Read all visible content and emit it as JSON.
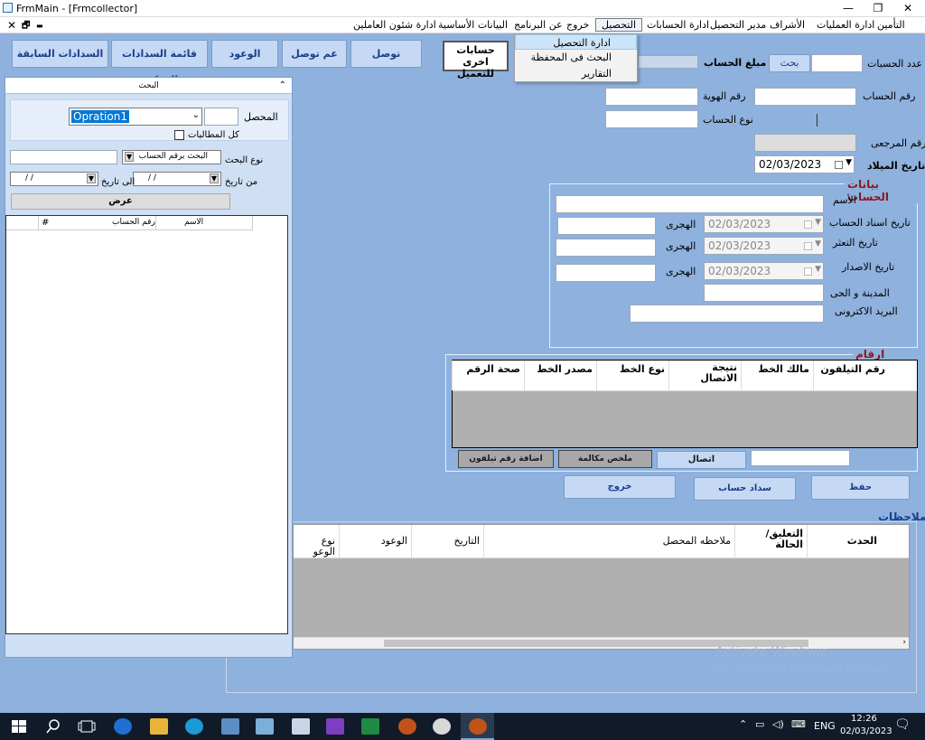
{
  "window": {
    "title": "FrmMain - [Frmcollector]",
    "min": "—",
    "max": "❐",
    "close": "✕"
  },
  "mdi": {
    "close": "✕",
    "restore": "🗗",
    "min": "▬"
  },
  "menu": [
    "التأمين",
    "ادارة العمليات",
    "الأشراف",
    "مدير التحصيل",
    "ادارة الحسابات",
    "التحصيل",
    "خروج",
    "عن البرنامج",
    "البيانات الأساسية",
    "ادارة شئون العاملين"
  ],
  "dropdown": [
    "ادارة التحصيل",
    "البحث فى المحفظة",
    "التقارير"
  ],
  "toolbar": {
    "other_accounts": "حسابات اخرى للتعميل",
    "reach": "توصل",
    "no_reach": "عم توصل",
    "promises": "الوعود",
    "confirmed_payments": "قائمة السدادات المؤكدة",
    "prev_payments": "السدادات السابقة"
  },
  "top": {
    "accounts_count_label": "عدد الحسبات",
    "search_btn": "بحث",
    "amount_label": "مبلغ الحساب",
    "account_no_label": "رقم الحساب",
    "id_no_label": "رقم الهوية",
    "account_type_label": "نوع الحساب",
    "ref_no_label": "الرقم المرجعى",
    "dob_label": "تاريخ الميلاد",
    "dob_value": "02/03/2023"
  },
  "account_data": {
    "title": "بيانات الحساب",
    "name_label": "الأسم",
    "assign_date_label": "تاريخ اسناد الحساب",
    "default_date_label": "تاريخ التعثر",
    "issue_date_label": "تاريخ الاصدار",
    "hijri_label": "الهجرى",
    "date_value": "02/03/2023",
    "city_label": "المدينة و الحى",
    "email_label": "البريد الاكترونى"
  },
  "contacts": {
    "title": "ارقام الاتصال",
    "columns": [
      "رقم التيلفون",
      "مالك الخط",
      "نتيجة الاتصال",
      "نوع الخط",
      "مصدر الخط",
      "صحة الرقم"
    ],
    "call_btn": "اتصال",
    "call_summary_btn": "ملخص مكالمة",
    "add_phone_btn": "اضافة رقم تيلفون"
  },
  "actions": {
    "save": "حفظ",
    "pay_account": "سداد حساب",
    "exit": "خروج"
  },
  "notes": {
    "title": "ملاحظات",
    "columns": [
      "الحدث",
      "التعليق/ الحالة",
      "ملاحظه المحصل",
      "التاريخ",
      "الوعود",
      "نوع الوعو"
    ]
  },
  "search_panel": {
    "title": "البحث",
    "collapse": "⌃",
    "collector_label": "المحصل",
    "collector_value": "Opration1",
    "all_claims_label": "كل المطالبات",
    "search_type_label": "نوع البحث",
    "search_type_value": "البحث برقم الحساب",
    "from_date_label": "من تاريخ",
    "to_date_label": "الى تاريخ",
    "date_blank": "/ /",
    "show_btn": "عرض",
    "columns": [
      "الاسم",
      "رقم الحساب",
      "#"
    ]
  },
  "watermark": {
    "line1": "Activate Windows",
    "line2": "Go to Settings to activate Windows."
  },
  "taskbar": {
    "lang": "ENG",
    "time": "12:26",
    "date": "02/03/2023"
  }
}
